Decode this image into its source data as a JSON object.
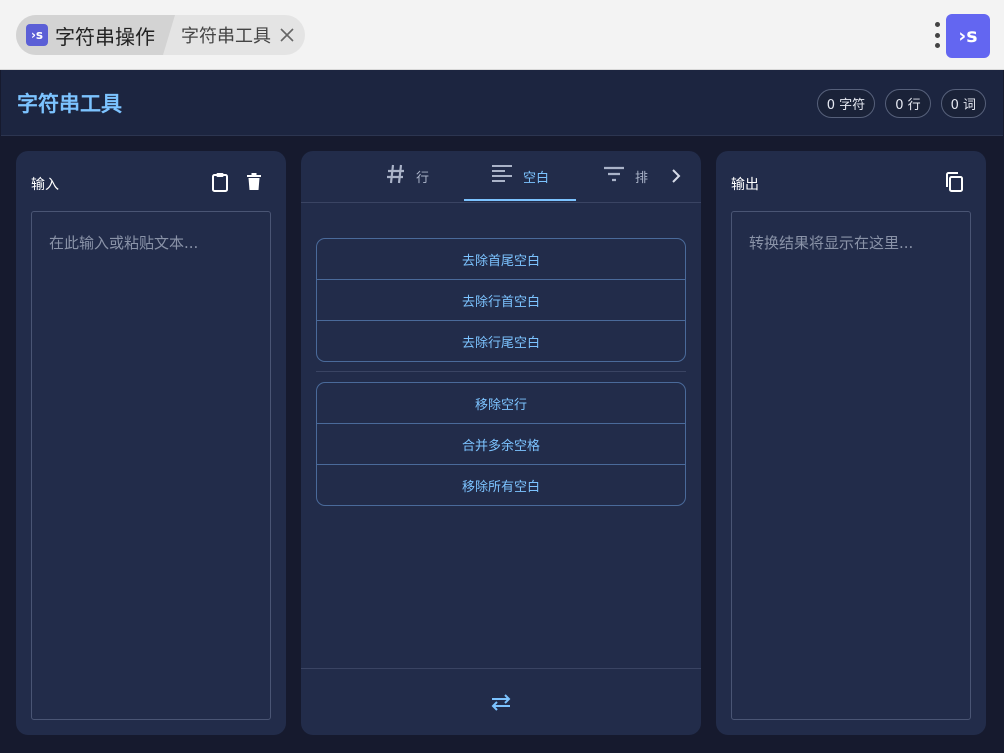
{
  "topbar": {
    "app_badge": "›s",
    "app_name": "字符串操作",
    "tool_name": "字符串工具",
    "brand_badge": "›s",
    "close_icon": "close-icon",
    "menu_icon": "kebab-icon"
  },
  "header": {
    "title": "字符串工具",
    "stats": {
      "chars": "0 字符",
      "lines": "0 行",
      "words": "0 词"
    }
  },
  "input_panel": {
    "title": "输入",
    "placeholder": "在此输入或粘贴文本...",
    "paste_icon": "clipboard-icon",
    "clear_icon": "trash-icon"
  },
  "tools_panel": {
    "tabs": [
      {
        "label": "行",
        "icon": "hash-icon"
      },
      {
        "label": "空白",
        "icon": "align-left-icon",
        "active": true
      },
      {
        "label": "排",
        "icon": "filter-icon"
      }
    ],
    "groups": [
      {
        "ops": [
          "去除首尾空白",
          "去除行首空白",
          "去除行尾空白"
        ]
      },
      {
        "ops": [
          "移除空行",
          "合并多余空格",
          "移除所有空白"
        ]
      }
    ],
    "swap_icon": "swap-icon"
  },
  "output_panel": {
    "title": "输出",
    "placeholder": "转换结果将显示在这里...",
    "copy_icon": "copy-icon"
  },
  "colors": {
    "accent": "#7cc3ff",
    "panel": "#222c4a",
    "brand": "#6366f1"
  }
}
